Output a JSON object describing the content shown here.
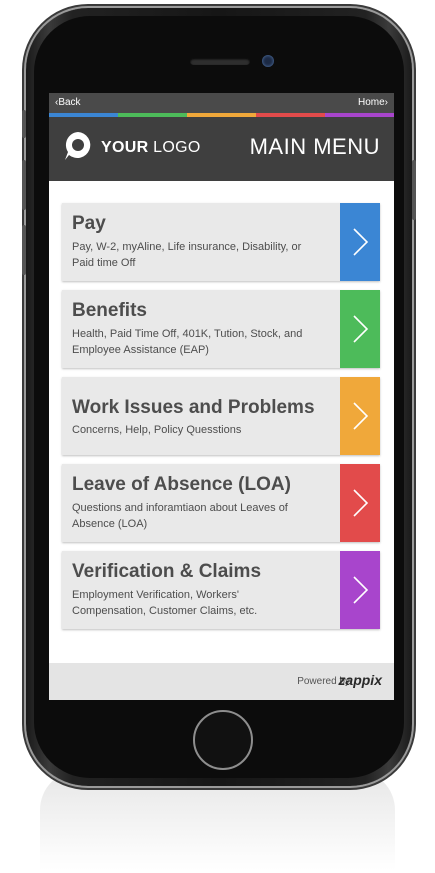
{
  "topbar": {
    "back_label": "‹Back",
    "home_label": "Home›"
  },
  "stripe_colors": [
    "#3b86d4",
    "#4dbb5a",
    "#f0a83a",
    "#e24b4b",
    "#a845cc"
  ],
  "header": {
    "logo_bold": "YOUR",
    "logo_regular": " LOGO",
    "menu_title": "MAIN MENU"
  },
  "menu": {
    "items": [
      {
        "title": "Pay",
        "description": "Pay, W-2, myAline, Life insurance, Disability, or Paid time Off",
        "color": "#3b86d4"
      },
      {
        "title": "Benefits",
        "description": "Health, Paid Time Off, 401K, Tution, Stock, and Employee Assistance (EAP)",
        "color": "#4dbb5a"
      },
      {
        "title": "Work Issues and Problems",
        "description": "Concerns, Help, Policy Quesstions",
        "color": "#f0a83a"
      },
      {
        "title": "Leave of Absence (LOA)",
        "description": "Questions and inforamtiaon about Leaves of Absence (LOA)",
        "color": "#e24b4b"
      },
      {
        "title": "Verification & Claims",
        "description": "Employment Verification, Workers' Compensation, Customer Claims, etc.",
        "color": "#a845cc"
      }
    ]
  },
  "footer": {
    "powered_by": "Powered by",
    "brand": "zappix"
  }
}
